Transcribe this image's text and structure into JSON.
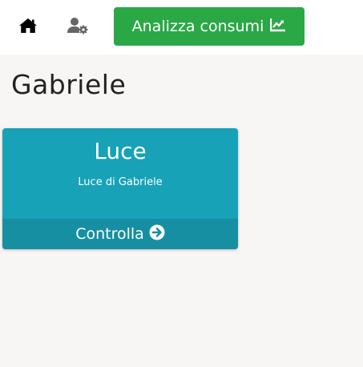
{
  "nav": {
    "home_icon": "home-icon",
    "user_settings_icon": "user-cog-icon",
    "analyze_button_label": "Analizza consumi",
    "analyze_icon": "line-chart-icon"
  },
  "page": {
    "title": "Gabriele"
  },
  "card": {
    "title": "Luce",
    "subtitle": "Luce di Gabriele",
    "footer_label": "Controlla",
    "footer_icon": "arrow-circle-right-icon"
  },
  "colors": {
    "accent_green": "#2aa845",
    "card_teal": "#17a2b8",
    "card_footer_teal": "#168fa2",
    "background": "#f7f6f4"
  }
}
